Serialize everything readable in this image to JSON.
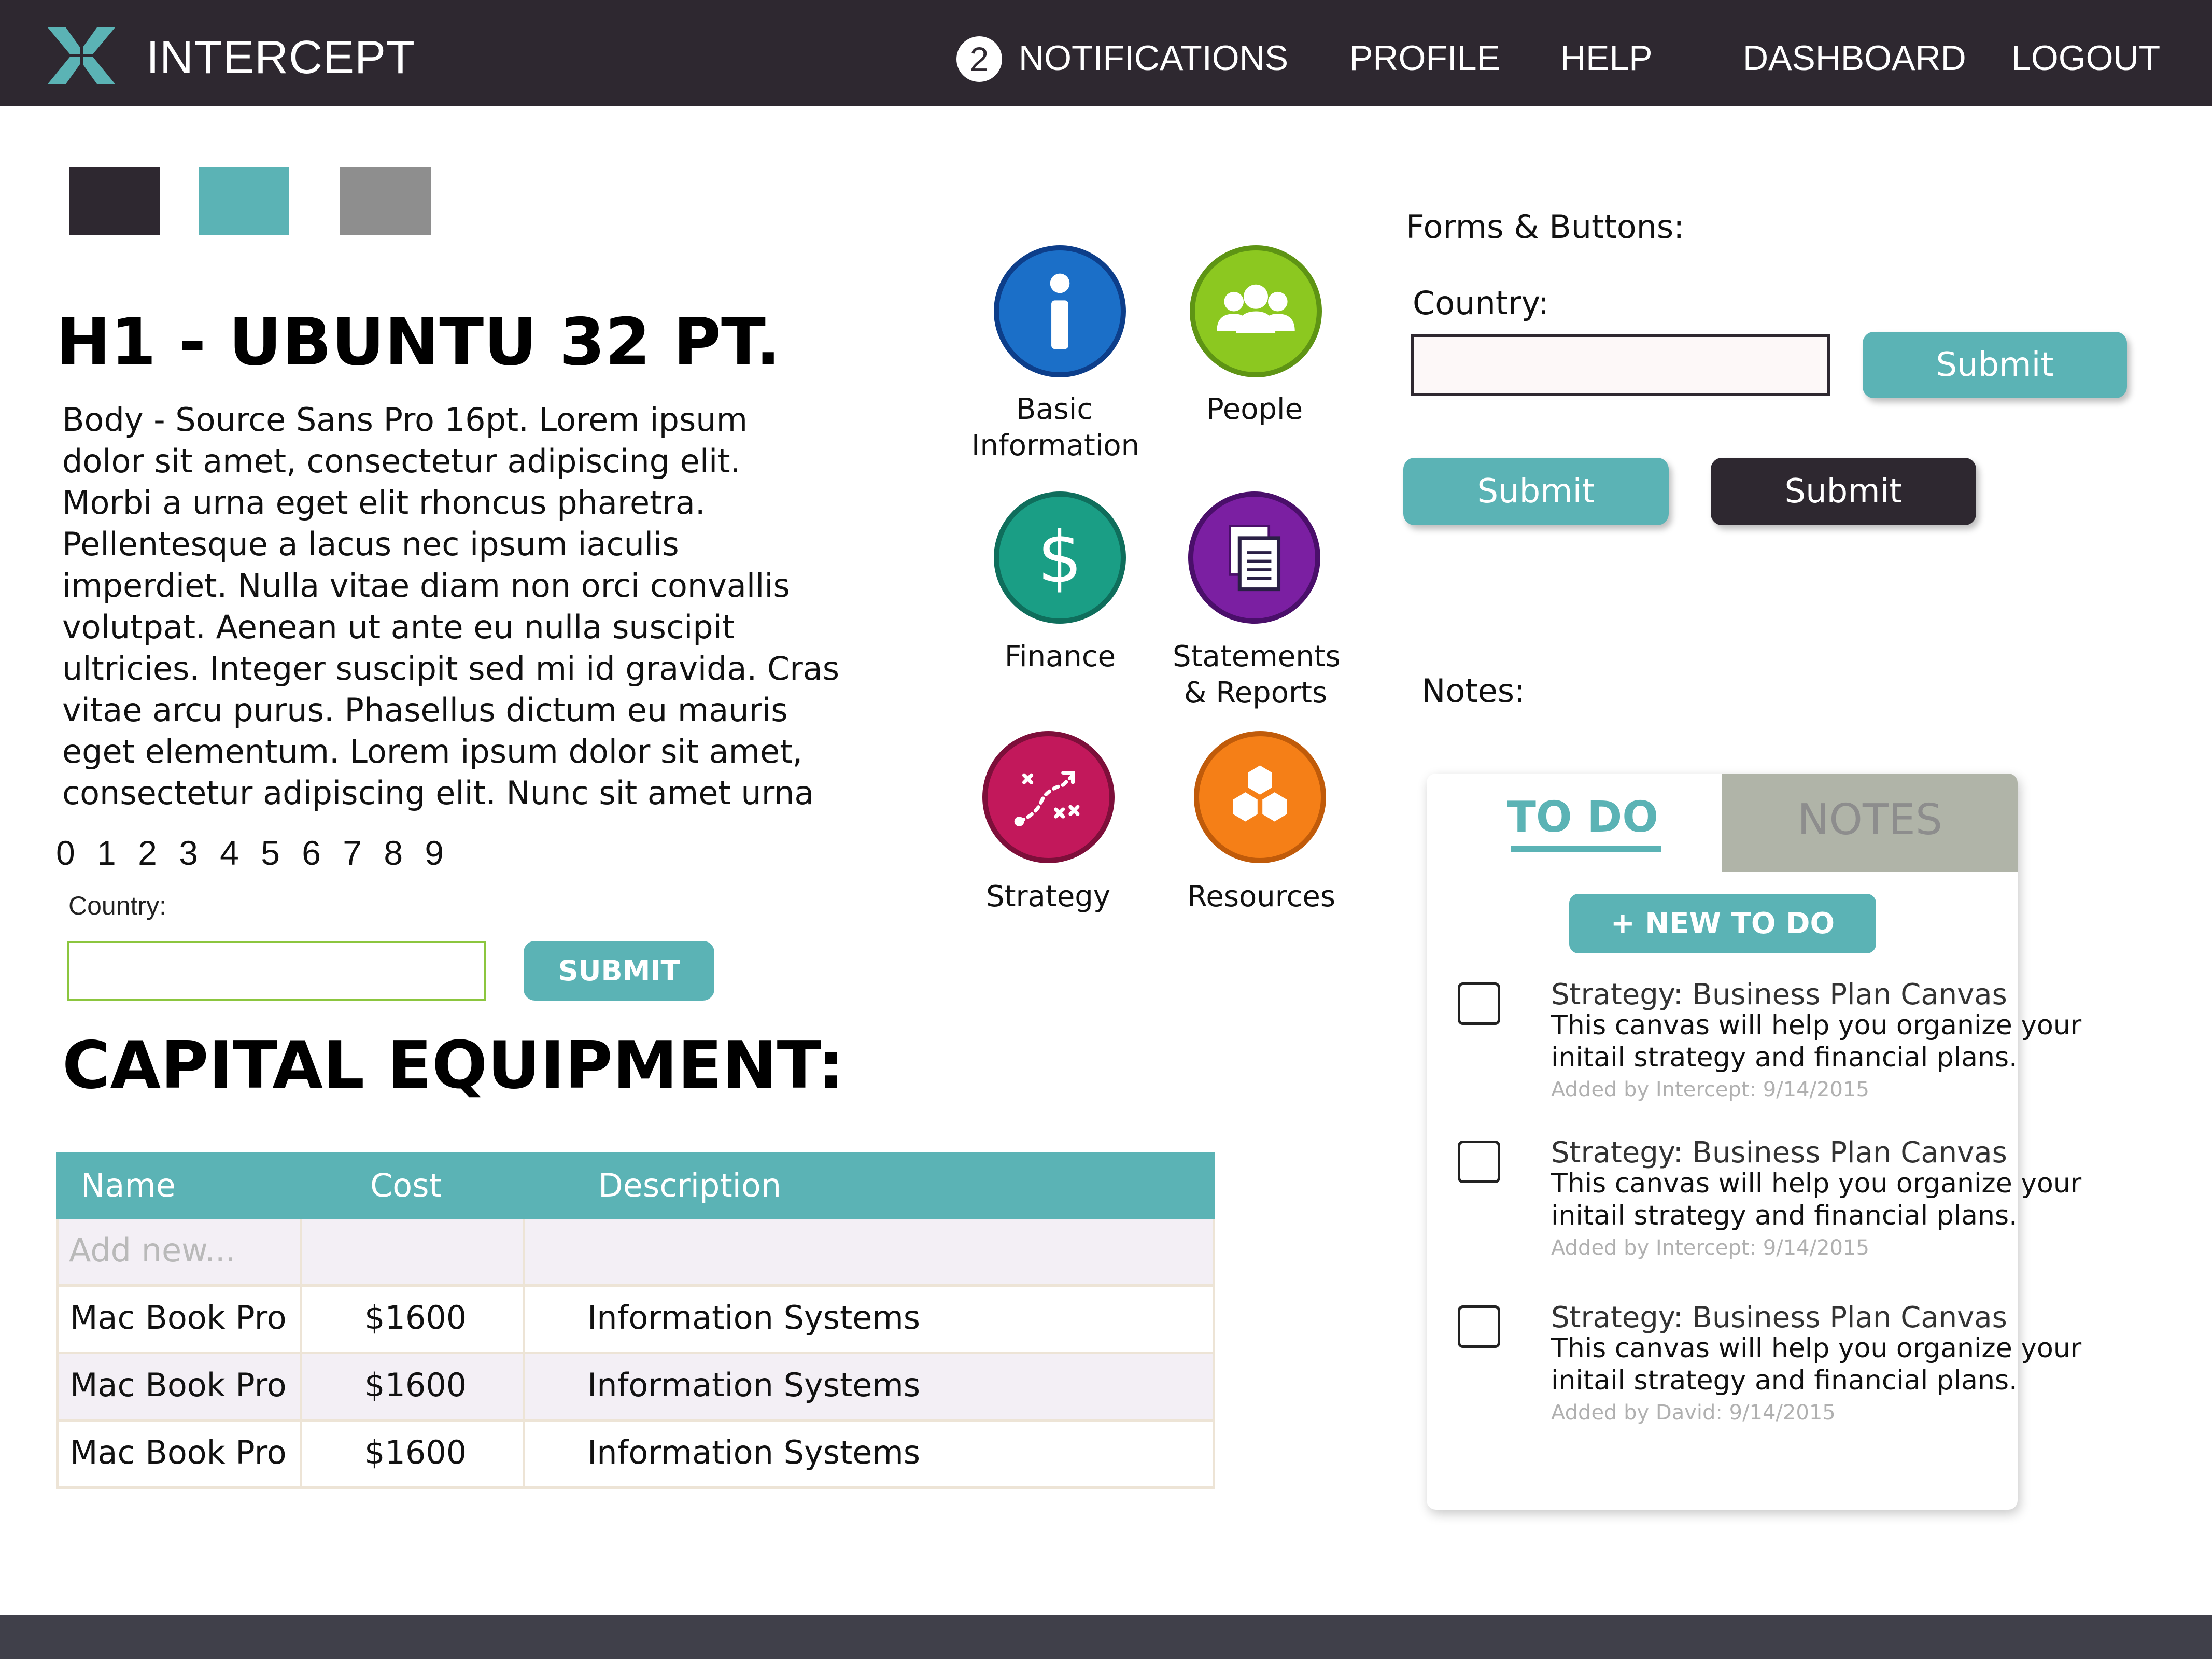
{
  "brand": {
    "name": "INTERCEPT",
    "logo_icon": "intercept-x-logo-icon",
    "logo_color": "#5bb3b5"
  },
  "nav": {
    "notification_count": "2",
    "notifications": "NOTIFICATIONS",
    "profile": "PROFILE",
    "help": "HELP",
    "dashboard": "DASHBOARD",
    "logout": "LOGOUT"
  },
  "palette": [
    "#2e2830",
    "#5bb3b5",
    "#8e8e8e"
  ],
  "typography": {
    "h1": "H1 - UBUNTU 32 PT.",
    "body_lines": [
      "Body - Source Sans Pro 16pt. Lorem ipsum",
      "dolor sit amet, consectetur adipiscing elit.",
      "Morbi a urna eget elit rhoncus pharetra.",
      "Pellentesque a lacus nec ipsum iaculis",
      "imperdiet. Nulla vitae diam non orci convallis",
      "volutpat. Aenean ut ante eu nulla suscipit",
      "ultricies. Integer suscipit sed mi id gravida. Cras",
      "vitae arcu purus. Phasellus dictum eu mauris",
      "eget elementum. Lorem ipsum dolor sit amet,",
      "consectetur adipiscing elit. Nunc sit amet urna"
    ],
    "digits": "0 1 2 3 4 5 6 7 8 9"
  },
  "small_form": {
    "label": "Country:",
    "submit": "SUBMIT"
  },
  "capital": {
    "title": "CAPITAL EQUIPMENT:",
    "columns": [
      "Name",
      "Cost",
      "Description"
    ],
    "placeholder": "Add new...",
    "rows": [
      [
        "Mac Book Pro",
        "$1600",
        "Information Systems"
      ],
      [
        "Mac Book Pro",
        "$1600",
        "Information Systems"
      ],
      [
        "Mac Book Pro",
        "$1600",
        "Information Systems"
      ]
    ]
  },
  "icons": [
    {
      "label1": "Basic",
      "label2": "Information",
      "icon": "info-icon",
      "color": "#1b6fc8"
    },
    {
      "label1": "People",
      "label2": "",
      "icon": "people-icon",
      "color": "#8cc820"
    },
    {
      "label1": "Finance",
      "label2": "",
      "icon": "dollar-icon",
      "color": "#1a9e85"
    },
    {
      "label1": "Statements",
      "label2": "& Reports",
      "icon": "document-icon",
      "color": "#7b1fa2"
    },
    {
      "label1": "Strategy",
      "label2": "",
      "icon": "strategy-icon",
      "color": "#c2185b"
    },
    {
      "label1": "Resources",
      "label2": "",
      "icon": "hexagons-icon",
      "color": "#f57f17"
    }
  ],
  "forms": {
    "heading": "Forms & Buttons:",
    "country_label": "Country:",
    "submit_1": "Submit",
    "submit_2": "Submit",
    "submit_3": "Submit"
  },
  "notes": {
    "heading": "Notes:",
    "tab_todo": "TO DO",
    "tab_notes": "NOTES",
    "new_todo": "+ NEW TO DO",
    "items": [
      {
        "title": "Strategy: Business Plan Canvas",
        "desc1": "This canvas will help you organize your",
        "desc2": "initail strategy and financial plans.",
        "meta": "Added by Intercept: 9/14/2015"
      },
      {
        "title": "Strategy: Business Plan Canvas",
        "desc1": "This canvas will help you organize your",
        "desc2": "initail strategy and financial plans.",
        "meta": "Added by Intercept: 9/14/2015"
      },
      {
        "title": "Strategy: Business Plan Canvas",
        "desc1": "This canvas will help you organize your",
        "desc2": "initail strategy and financial plans.",
        "meta": "Added by David: 9/14/2015"
      }
    ]
  }
}
